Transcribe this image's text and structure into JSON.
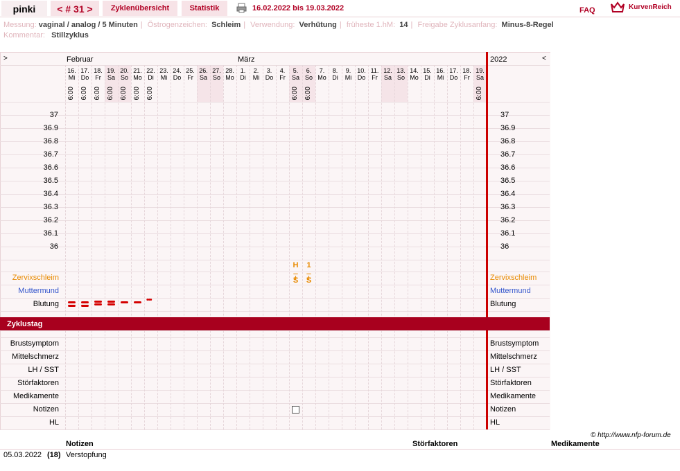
{
  "header": {
    "user": "pinki",
    "cycle": "< # 31 >",
    "tabs": [
      "Zyklenübersicht",
      "Statistik"
    ],
    "date_range": "16.02.2022 bis 19.03.2022",
    "faq": "FAQ",
    "brand": "KurvenReich"
  },
  "info": {
    "messung_label": "Messung:",
    "messung": "vaginal / analog / 5 Minuten",
    "oestrogen_label": "Östrogenzeichen:",
    "oestrogen": "Schleim",
    "verwendung_label": "Verwendung:",
    "verwendung": "Verhütung",
    "fruehe_label": "früheste 1.hM:",
    "fruehe": "14",
    "freigabe_label": "Freigabe Zyklusanfang:",
    "freigabe": "Minus-8-Regel",
    "kommentar_label": "Kommentar:",
    "kommentar": "Stillzyklus"
  },
  "chart": {
    "nav_left": ">",
    "nav_right": "<",
    "month1": "Februar",
    "month2": "März",
    "year": "2022",
    "days": [
      {
        "d": "16.",
        "w": "Mi",
        "t": "6:00"
      },
      {
        "d": "17.",
        "w": "Do",
        "t": "6:00"
      },
      {
        "d": "18.",
        "w": "Fr",
        "t": "6:00"
      },
      {
        "d": "19.",
        "w": "Sa",
        "t": "6:00"
      },
      {
        "d": "20.",
        "w": "So",
        "t": "6:00"
      },
      {
        "d": "21.",
        "w": "Mo",
        "t": "6:00"
      },
      {
        "d": "22.",
        "w": "Di",
        "t": "6:00"
      },
      {
        "d": "23.",
        "w": "Mi",
        "t": ""
      },
      {
        "d": "24.",
        "w": "Do",
        "t": ""
      },
      {
        "d": "25.",
        "w": "Fr",
        "t": ""
      },
      {
        "d": "26.",
        "w": "Sa",
        "t": ""
      },
      {
        "d": "27.",
        "w": "So",
        "t": ""
      },
      {
        "d": "28.",
        "w": "Mo",
        "t": ""
      },
      {
        "d": "1.",
        "w": "Di",
        "t": ""
      },
      {
        "d": "2.",
        "w": "Mi",
        "t": ""
      },
      {
        "d": "3.",
        "w": "Do",
        "t": ""
      },
      {
        "d": "4.",
        "w": "Fr",
        "t": ""
      },
      {
        "d": "5.",
        "w": "Sa",
        "t": "6:00"
      },
      {
        "d": "6.",
        "w": "So",
        "t": "6:00"
      },
      {
        "d": "7.",
        "w": "Mo",
        "t": ""
      },
      {
        "d": "8.",
        "w": "Di",
        "t": ""
      },
      {
        "d": "9.",
        "w": "Mi",
        "t": ""
      },
      {
        "d": "10.",
        "w": "Do",
        "t": ""
      },
      {
        "d": "11.",
        "w": "Fr",
        "t": ""
      },
      {
        "d": "12.",
        "w": "Sa",
        "t": ""
      },
      {
        "d": "13.",
        "w": "So",
        "t": ""
      },
      {
        "d": "14.",
        "w": "Mo",
        "t": ""
      },
      {
        "d": "15.",
        "w": "Di",
        "t": ""
      },
      {
        "d": "16.",
        "w": "Mi",
        "t": ""
      },
      {
        "d": "17.",
        "w": "Do",
        "t": ""
      },
      {
        "d": "18.",
        "w": "Fr",
        "t": ""
      },
      {
        "d": "19.",
        "w": "Sa",
        "t": "6:00"
      }
    ],
    "temps": [
      "37",
      "36.9",
      "36.8",
      "36.7",
      "36.6",
      "36.5",
      "36.4",
      "36.3",
      "36.2",
      "36.1",
      "36"
    ],
    "rows_top": [
      "Zervixschleim",
      "Muttermund",
      "Blutung"
    ],
    "zyklustag_label": "Zyklustag",
    "rows_bottom": [
      "Brustsymptom",
      "Mittelschmerz",
      "LH / SST",
      "Störfaktoren",
      "Medikamente",
      "Notizen",
      "HL"
    ],
    "mucus": [
      {
        "day": 18,
        "top": "H",
        "bottom": "S"
      },
      {
        "day": 19,
        "top": "1",
        "bottom": "S"
      }
    ],
    "bleeding": [
      3,
      3,
      2,
      2,
      1,
      1,
      0.5
    ],
    "note_day": 18
  },
  "footer": {
    "copyright": "© http://www.nfp-forum.de",
    "col_notizen": "Notizen",
    "col_stoer": "Störfaktoren",
    "col_medi": "Medikamente",
    "entry_date": "05.03.2022",
    "entry_day": "(18)",
    "entry_text": "Verstopfung"
  },
  "colors": {
    "accent": "#b10024",
    "bar": "#a8001e",
    "mucus": "#e88a00",
    "muttermund": "#3355cc"
  }
}
